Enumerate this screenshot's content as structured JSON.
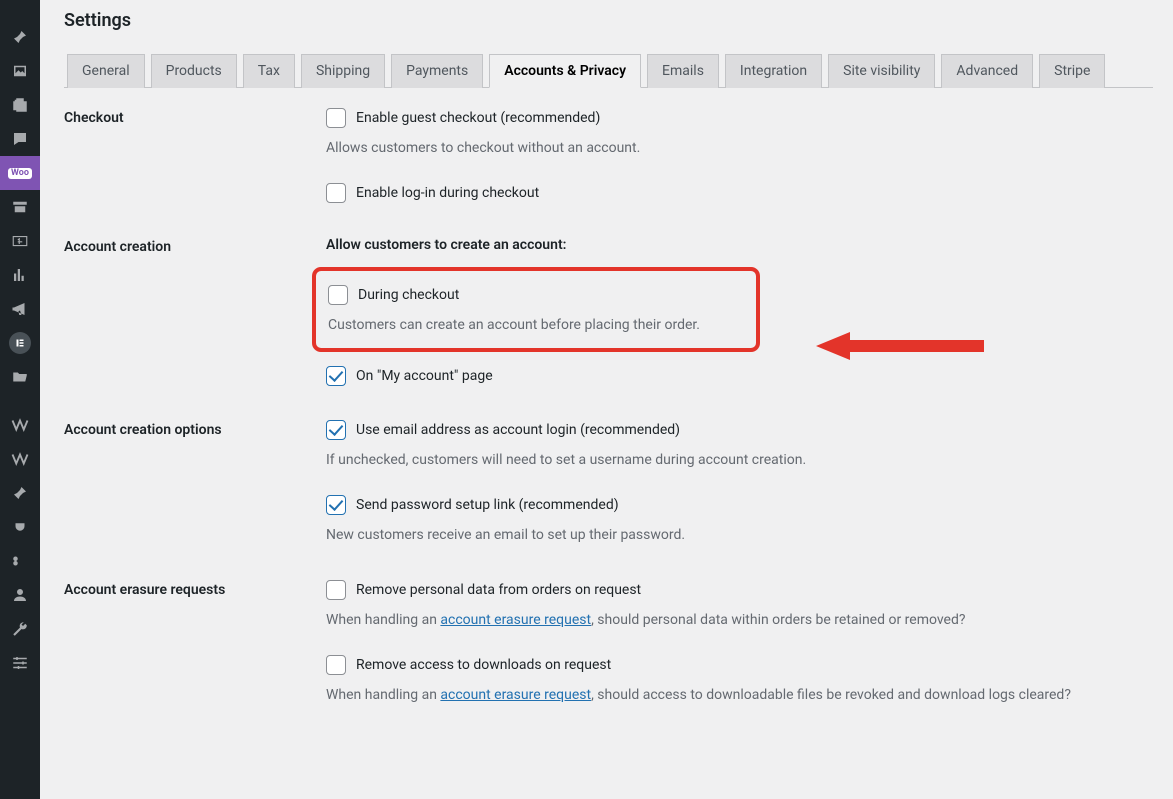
{
  "page": {
    "title": "Settings"
  },
  "tabs": [
    {
      "label": "General"
    },
    {
      "label": "Products"
    },
    {
      "label": "Tax"
    },
    {
      "label": "Shipping"
    },
    {
      "label": "Payments"
    },
    {
      "label": "Accounts & Privacy",
      "active": true
    },
    {
      "label": "Emails"
    },
    {
      "label": "Integration"
    },
    {
      "label": "Site visibility"
    },
    {
      "label": "Advanced"
    },
    {
      "label": "Stripe"
    }
  ],
  "checkout": {
    "heading": "Checkout",
    "guest_label": "Enable guest checkout (recommended)",
    "guest_desc": "Allows customers to checkout without an account.",
    "login_label": "Enable log-in during checkout"
  },
  "account_creation": {
    "heading": "Account creation",
    "legend": "Allow customers to create an account:",
    "during_checkout_label": "During checkout",
    "during_checkout_desc": "Customers can create an account before placing their order.",
    "my_account_label": "On \"My account\" page"
  },
  "account_options": {
    "heading": "Account creation options",
    "email_login_label": "Use email address as account login (recommended)",
    "email_login_desc": "If unchecked, customers will need to set a username during account creation.",
    "pw_link_label": "Send password setup link (recommended)",
    "pw_link_desc": "New customers receive an email to set up their password."
  },
  "erasure": {
    "heading": "Account erasure requests",
    "remove_orders_label": "Remove personal data from orders on request",
    "orders_desc_pre": "When handling an ",
    "orders_desc_link": "account erasure request",
    "orders_desc_post": ", should personal data within orders be retained or removed?",
    "remove_downloads_label": "Remove access to downloads on request",
    "downloads_desc_pre": "When handling an ",
    "downloads_desc_link": "account erasure request",
    "downloads_desc_post": ", should access to downloadable files be revoked and download logs cleared?"
  },
  "sidebar": {
    "woo_badge": "Woo"
  }
}
